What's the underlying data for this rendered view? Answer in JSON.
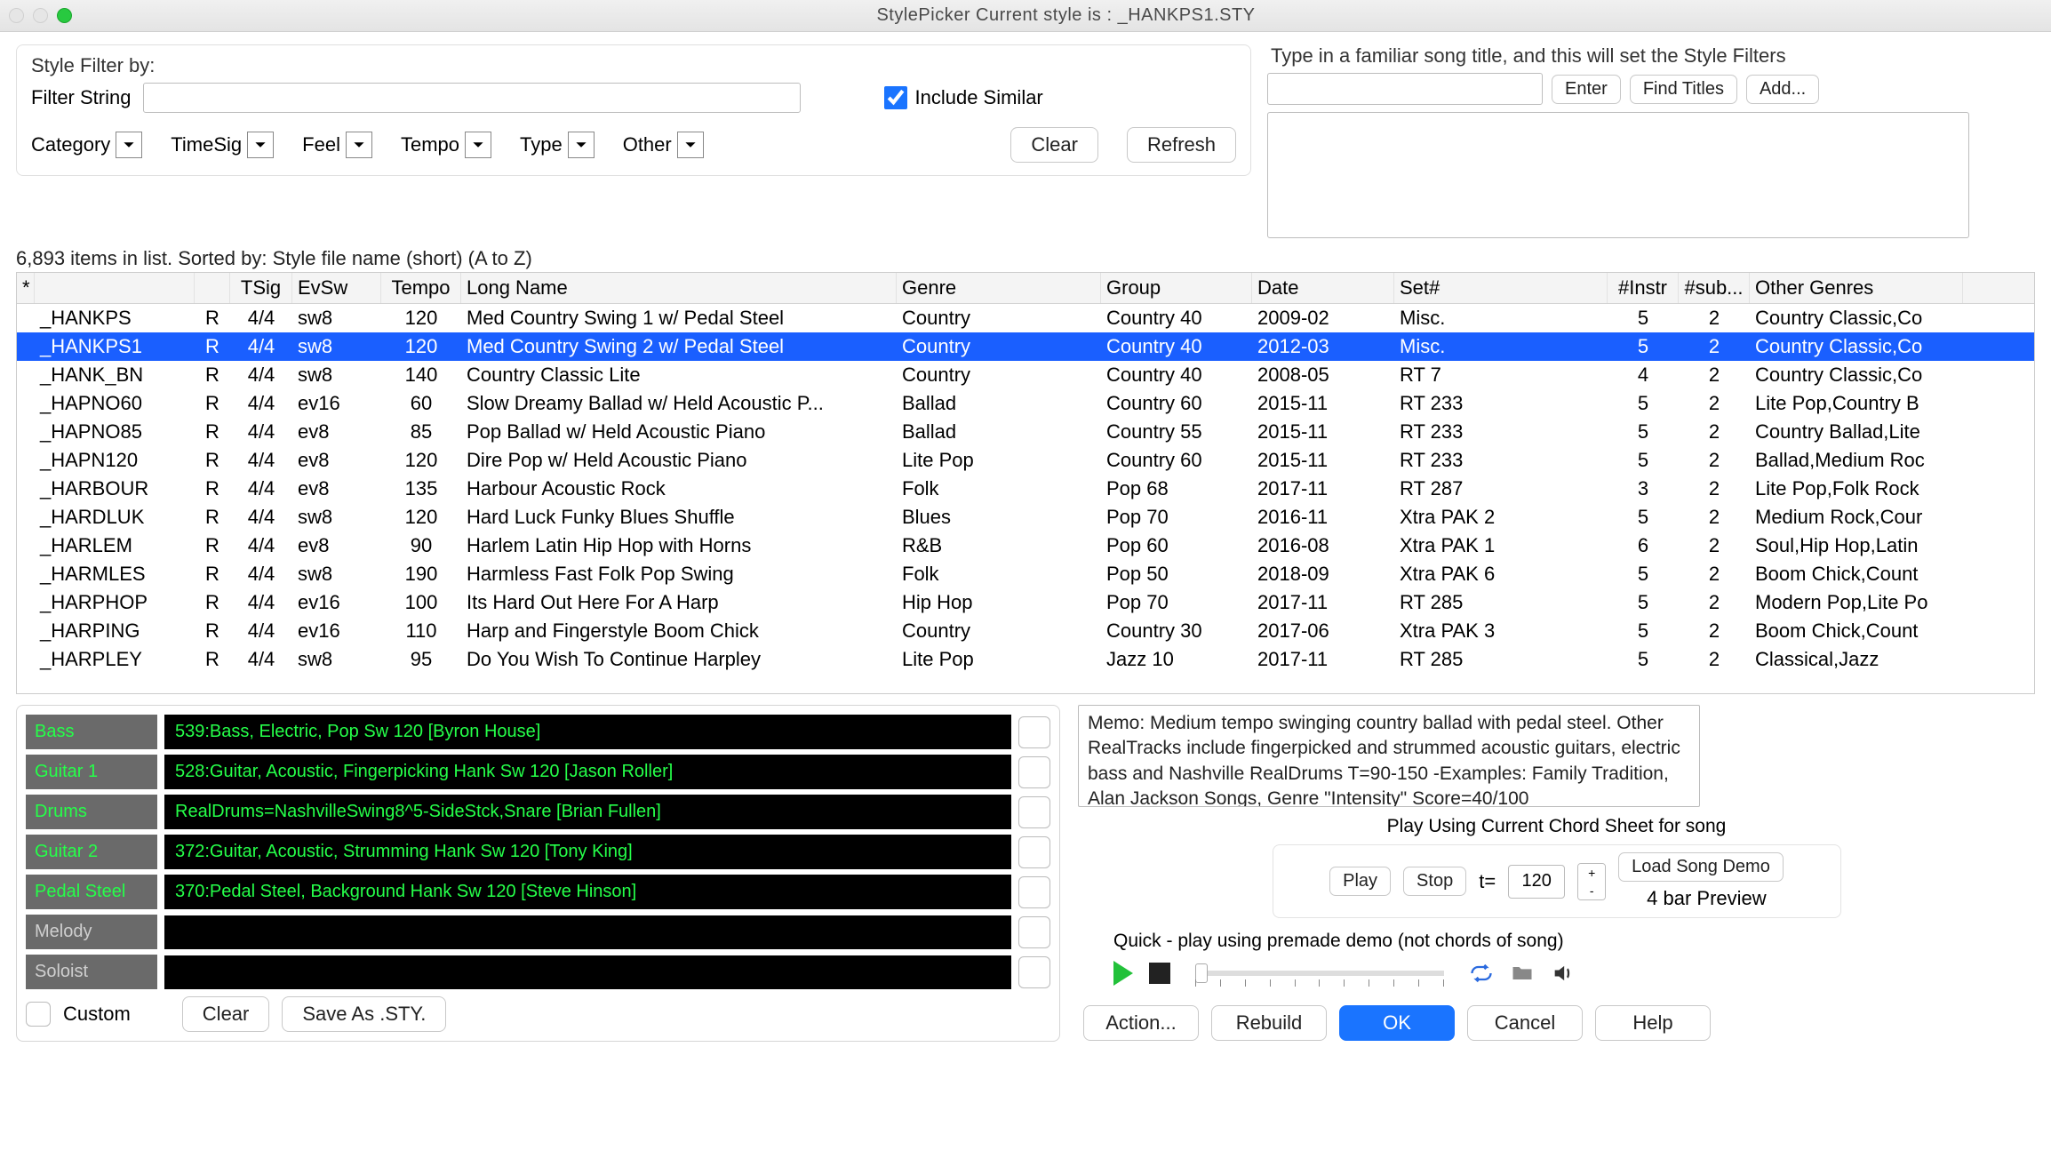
{
  "window": {
    "title": "StylePicker    Current style is : _HANKPS1.STY"
  },
  "filter": {
    "heading": "Style Filter by:",
    "filter_string_label": "Filter String",
    "include_similar": "Include Similar",
    "include_similar_checked": true,
    "categories": [
      "Category",
      "TimeSig",
      "Feel",
      "Tempo",
      "Type",
      "Other"
    ],
    "clear": "Clear",
    "refresh": "Refresh"
  },
  "song": {
    "hint": "Type in a familiar song title, and this will set the Style Filters",
    "enter": "Enter",
    "find": "Find Titles",
    "add": "Add..."
  },
  "status": "6,893 items in list. Sorted by: Style file name (short)  (A to Z)",
  "cols": {
    "star": "*",
    "name": "",
    "r": "",
    "tsig": "TSig",
    "ev": "EvSw",
    "tempo": "Tempo",
    "long": "Long Name",
    "genre": "Genre",
    "group": "Group",
    "date": "Date",
    "set": "Set#",
    "instr": "#Instr",
    "sub": "#sub...",
    "other": "Other Genres"
  },
  "rows": [
    {
      "name": "_HANKPS",
      "r": "R",
      "ts": "4/4",
      "ev": "sw8",
      "tempo": "120",
      "long": "Med Country Swing 1 w/ Pedal Steel",
      "genre": "Country",
      "group": "Country 40",
      "date": "2009-02",
      "set": "Misc.",
      "instr": "5",
      "sub": "2",
      "other": "Country Classic,Co"
    },
    {
      "name": "_HANKPS1",
      "r": "R",
      "ts": "4/4",
      "ev": "sw8",
      "tempo": "120",
      "long": "Med Country Swing 2 w/ Pedal Steel",
      "genre": "Country",
      "group": "Country 40",
      "date": "2012-03",
      "set": "Misc.",
      "instr": "5",
      "sub": "2",
      "other": "Country Classic,Co",
      "sel": true
    },
    {
      "name": "_HANK_BN",
      "r": "R",
      "ts": "4/4",
      "ev": "sw8",
      "tempo": "140",
      "long": "Country Classic Lite",
      "genre": "Country",
      "group": "Country 40",
      "date": "2008-05",
      "set": "RT 7",
      "instr": "4",
      "sub": "2",
      "other": "Country Classic,Co"
    },
    {
      "name": "_HAPNO60",
      "r": "R",
      "ts": "4/4",
      "ev": "ev16",
      "tempo": "60",
      "long": "Slow Dreamy Ballad w/ Held Acoustic P...",
      "genre": "Ballad",
      "group": "Country 60",
      "date": "2015-11",
      "set": "RT 233",
      "instr": "5",
      "sub": "2",
      "other": "Lite Pop,Country B"
    },
    {
      "name": "_HAPNO85",
      "r": "R",
      "ts": "4/4",
      "ev": "ev8",
      "tempo": "85",
      "long": "Pop Ballad w/ Held Acoustic Piano",
      "genre": "Ballad",
      "group": "Country 55",
      "date": "2015-11",
      "set": "RT 233",
      "instr": "5",
      "sub": "2",
      "other": "Country Ballad,Lite"
    },
    {
      "name": "_HAPN120",
      "r": "R",
      "ts": "4/4",
      "ev": "ev8",
      "tempo": "120",
      "long": "Dire Pop w/ Held Acoustic Piano",
      "genre": "Lite Pop",
      "group": "Country 60",
      "date": "2015-11",
      "set": "RT 233",
      "instr": "5",
      "sub": "2",
      "other": "Ballad,Medium Roc"
    },
    {
      "name": "_HARBOUR",
      "r": "R",
      "ts": "4/4",
      "ev": "ev8",
      "tempo": "135",
      "long": "Harbour Acoustic Rock",
      "genre": "Folk",
      "group": "Pop 68",
      "date": "2017-11",
      "set": "RT 287",
      "instr": "3",
      "sub": "2",
      "other": "Lite Pop,Folk Rock"
    },
    {
      "name": "_HARDLUK",
      "r": "R",
      "ts": "4/4",
      "ev": "sw8",
      "tempo": "120",
      "long": "Hard Luck Funky Blues Shuffle",
      "genre": "Blues",
      "group": "Pop 70",
      "date": "2016-11",
      "set": "Xtra PAK 2",
      "instr": "5",
      "sub": "2",
      "other": "Medium Rock,Cour"
    },
    {
      "name": "_HARLEM",
      "r": "R",
      "ts": "4/4",
      "ev": "ev8",
      "tempo": "90",
      "long": "Harlem Latin Hip Hop with Horns",
      "genre": "R&B",
      "group": "Pop 60",
      "date": "2016-08",
      "set": "Xtra PAK 1",
      "instr": "6",
      "sub": "2",
      "other": "Soul,Hip Hop,Latin"
    },
    {
      "name": "_HARMLES",
      "r": "R",
      "ts": "4/4",
      "ev": "sw8",
      "tempo": "190",
      "long": "Harmless Fast Folk Pop Swing",
      "genre": "Folk",
      "group": "Pop 50",
      "date": "2018-09",
      "set": "Xtra PAK 6",
      "instr": "5",
      "sub": "2",
      "other": "Boom Chick,Count"
    },
    {
      "name": "_HARPHOP",
      "r": "R",
      "ts": "4/4",
      "ev": "ev16",
      "tempo": "100",
      "long": "Its Hard Out Here For A Harp",
      "genre": "Hip Hop",
      "group": "Pop 70",
      "date": "2017-11",
      "set": "RT 285",
      "instr": "5",
      "sub": "2",
      "other": "Modern Pop,Lite Po"
    },
    {
      "name": "_HARPING",
      "r": "R",
      "ts": "4/4",
      "ev": "ev16",
      "tempo": "110",
      "long": "Harp and Fingerstyle Boom Chick",
      "genre": "Country",
      "group": "Country 30",
      "date": "2017-06",
      "set": "Xtra PAK 3",
      "instr": "5",
      "sub": "2",
      "other": "Boom Chick,Count"
    },
    {
      "name": "_HARPLEY",
      "r": "R",
      "ts": "4/4",
      "ev": "sw8",
      "tempo": "95",
      "long": "Do You Wish To Continue Harpley",
      "genre": "Lite Pop",
      "group": "Jazz 10",
      "date": "2017-11",
      "set": "RT 285",
      "instr": "5",
      "sub": "2",
      "other": "Classical,Jazz"
    }
  ],
  "tracks": {
    "items": [
      {
        "label": "Bass",
        "on": true,
        "val": "539:Bass, Electric, Pop Sw 120 [Byron House]"
      },
      {
        "label": "Guitar 1",
        "on": true,
        "val": "528:Guitar, Acoustic, Fingerpicking Hank Sw 120 [Jason Roller]"
      },
      {
        "label": "Drums",
        "on": true,
        "val": "RealDrums=NashvilleSwing8^5-SideStck,Snare [Brian Fullen]"
      },
      {
        "label": "Guitar 2",
        "on": true,
        "val": "372:Guitar, Acoustic, Strumming Hank Sw 120 [Tony King]"
      },
      {
        "label": "Pedal Steel",
        "on": true,
        "val": "370:Pedal Steel, Background Hank Sw 120 [Steve Hinson]"
      },
      {
        "label": "Melody",
        "on": false,
        "val": ""
      },
      {
        "label": "Soloist",
        "on": false,
        "val": ""
      }
    ],
    "custom": "Custom",
    "clear": "Clear",
    "saveas": "Save As .STY."
  },
  "memo": "Memo: Medium tempo swinging country ballad with pedal steel. Other RealTracks include fingerpicked and strummed acoustic guitars, electric bass and Nashville RealDrums T=90-150 -Examples: Family Tradition, Alan Jackson Songs, Genre \"Intensity\" Score=40/100",
  "play": {
    "heading": "Play Using Current Chord Sheet for song",
    "play": "Play",
    "stop": "Stop",
    "t_eq": "t=",
    "tempo": "120",
    "load": "Load Song Demo",
    "preview": "4 bar Preview",
    "quick": "Quick - play using premade demo (not chords of song)"
  },
  "footer": {
    "action": "Action...",
    "rebuild": "Rebuild",
    "ok": "OK",
    "cancel": "Cancel",
    "help": "Help"
  }
}
